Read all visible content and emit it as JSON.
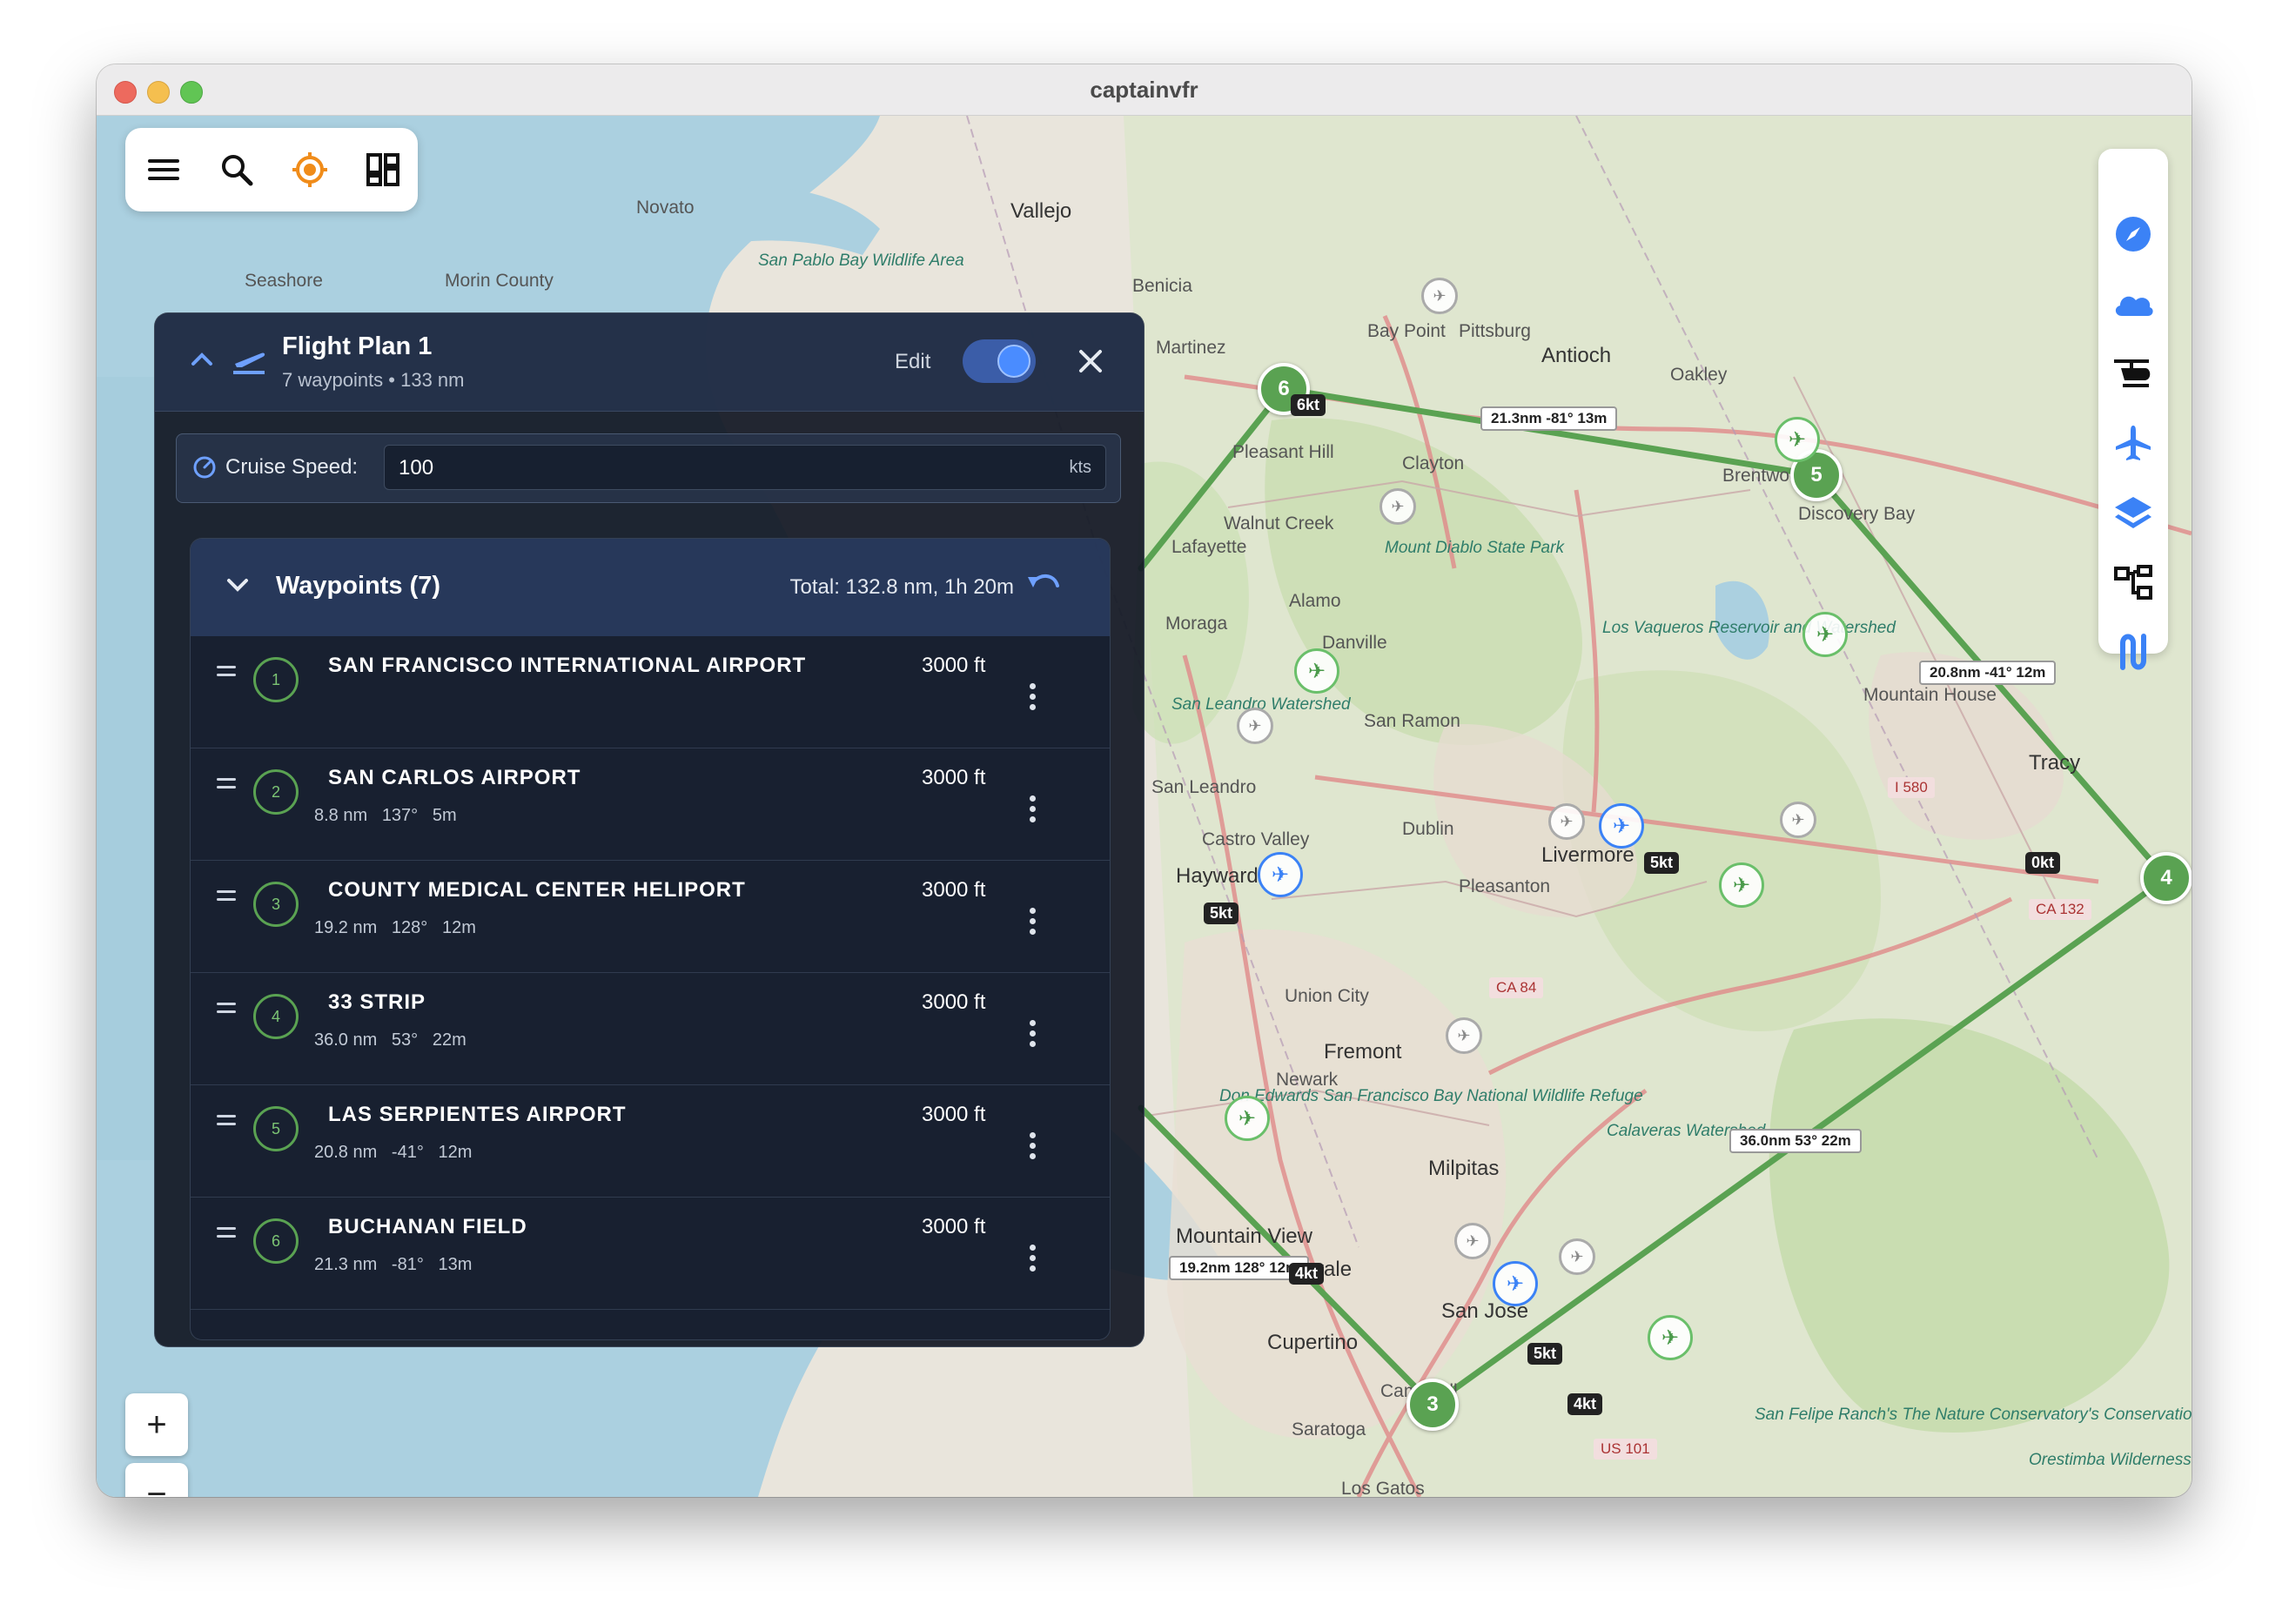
{
  "window": {
    "title": "captainvfr"
  },
  "panel": {
    "title": "Flight Plan 1",
    "subtitle": "7 waypoints • 133 nm",
    "edit_label": "Edit",
    "cruise_label": "Cruise Speed:",
    "cruise_value": "100",
    "cruise_unit": "kts",
    "waypoints_header": "Waypoints (7)",
    "total": "Total: 132.8 nm, 1h 20m",
    "waypoints": [
      {
        "num": "1",
        "name": "SAN FRANCISCO INTERNATIONAL AIRPORT",
        "meta": "",
        "alt": "3000 ft"
      },
      {
        "num": "2",
        "name": "SAN CARLOS AIRPORT",
        "meta": "8.8 nm   137°   5m",
        "alt": "3000 ft"
      },
      {
        "num": "3",
        "name": "COUNTY MEDICAL CENTER HELIPORT",
        "meta": "19.2 nm   128°   12m",
        "alt": "3000 ft"
      },
      {
        "num": "4",
        "name": "33 STRIP",
        "meta": "36.0 nm   53°   22m",
        "alt": "3000 ft"
      },
      {
        "num": "5",
        "name": "LAS SERPIENTES AIRPORT",
        "meta": "20.8 nm   -41°   12m",
        "alt": "3000 ft"
      },
      {
        "num": "6",
        "name": "BUCHANAN FIELD",
        "meta": "21.3 nm   -81°   13m",
        "alt": "3000 ft"
      }
    ]
  },
  "map": {
    "route_labels": {
      "l1": "21.3nm -81° 13m",
      "l2": "20.8nm -41° 12m",
      "l3": "36.0nm 53° 22m",
      "l4": "19.2nm 128° 12m"
    },
    "markers": {
      "m3": "3",
      "m4": "4",
      "m5": "5",
      "m6": "6"
    },
    "wind": {
      "w1": "6kt",
      "w2": "5kt",
      "w3": "0kt",
      "w4": "5kt",
      "w5": "4kt",
      "w6": "5kt",
      "w7": "4kt"
    },
    "places": {
      "vallejo": "Vallejo",
      "novato": "Novato",
      "seashore": "Seashore",
      "marin": "Morin County",
      "sanpablo": "San Pablo Bay Wildlife Area",
      "benicia": "Benicia",
      "martinez": "Martinez",
      "baypoint": "Bay Point",
      "pittsburg": "Pittsburg",
      "antioch": "Antioch",
      "oakley": "Oakley",
      "brentwood": "Brentwood",
      "discovery": "Discovery Bay",
      "clayton": "Clayton",
      "pleasanthill": "Pleasant Hill",
      "walnutcreek": "Walnut Creek",
      "lafayette": "Lafayette",
      "diablo": "Mount Diablo State Park",
      "vaqueros": "Los Vaqueros Reservoir and Watershed",
      "moraga": "Moraga",
      "alamo": "Alamo",
      "danville": "Danville",
      "mountainhouse": "Mountain House",
      "sanleandrow": "San Leandro Watershed",
      "sanramon": "San Ramon",
      "tracy": "Tracy",
      "sanleandro": "San Leandro",
      "i580": "I 580",
      "castrovalley": "Castro Valley",
      "dublin": "Dublin",
      "hayward": "Hayward",
      "livermore": "Livermore",
      "pleasanton": "Pleasanton",
      "ca132": "CA 132",
      "ca84": "CA 84",
      "unioncity": "Union City",
      "fremont": "Fremont",
      "newark": "Newark",
      "donedwards": "Don Edwards San Francisco Bay National Wildlife Refuge",
      "calaveras": "Calaveras Watershed",
      "milpitas": "Milpitas",
      "mountainview": "Mountain View",
      "sunnyvale": "Sunnyvale",
      "sanjose": "San Jose",
      "cupertino": "Cupertino",
      "campbell": "Campbell",
      "saratoga": "Saratoga",
      "sanfelipe": "San Felipe Ranch's The Nature Conservatory's Conservation",
      "us101": "US 101",
      "orestimba": "Orestimba Wilderness",
      "losgatos": "Los Gatos"
    }
  },
  "colors": {
    "route": "#5aa252",
    "panel": "#121823",
    "accent": "#4a8cff"
  }
}
